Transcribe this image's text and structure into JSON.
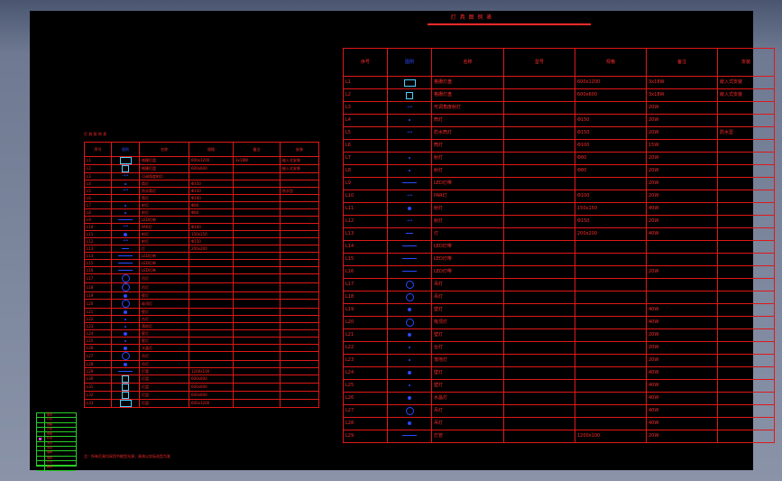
{
  "drawing": {
    "title": "灯 具 图 例 表"
  },
  "big_table": {
    "headers": [
      "序号",
      "图例",
      "名称",
      "型号",
      "规格",
      "备注",
      "安装"
    ],
    "rows": [
      {
        "no": "L1",
        "sym": "box",
        "name": "格栅灯盘",
        "model": "",
        "spec": "600x1200",
        "note": "3x18W",
        "install": "嵌入式安装"
      },
      {
        "no": "L2",
        "sym": "sq",
        "name": "格栅灯盘",
        "model": "",
        "spec": "600x600",
        "note": "3x18W",
        "install": "嵌入式安装"
      },
      {
        "no": "L3",
        "sym": "arrow",
        "name": "可调角度射灯",
        "model": "",
        "spec": "",
        "note": "20W",
        "install": ""
      },
      {
        "no": "L4",
        "sym": "dot-s",
        "name": "筒灯",
        "model": "",
        "spec": "Φ150",
        "note": "20W",
        "install": ""
      },
      {
        "no": "L5",
        "sym": "arrow",
        "name": "防水筒灯",
        "model": "",
        "spec": "Φ150",
        "note": "20W",
        "install": "防水型"
      },
      {
        "no": "L6",
        "sym": "blank",
        "name": "筒灯",
        "model": "",
        "spec": "Φ100",
        "note": "15W",
        "install": ""
      },
      {
        "no": "L7",
        "sym": "dot-s",
        "name": "射灯",
        "model": "",
        "spec": "Φ80",
        "note": "20W",
        "install": ""
      },
      {
        "no": "L8",
        "sym": "dot-s",
        "name": "射灯",
        "model": "",
        "spec": "Φ80",
        "note": "20W",
        "install": ""
      },
      {
        "no": "L9",
        "sym": "line",
        "name": "LED灯带",
        "model": "",
        "spec": "",
        "note": "20W",
        "install": ""
      },
      {
        "no": "L10",
        "sym": "arrow",
        "name": "PAR灯",
        "model": "",
        "spec": "Φ100",
        "note": "20W",
        "install": ""
      },
      {
        "no": "L11",
        "sym": "dot",
        "name": "射灯",
        "model": "",
        "spec": "150x150",
        "note": "40W",
        "install": ""
      },
      {
        "no": "L12",
        "sym": "arrow",
        "name": "射灯",
        "model": "",
        "spec": "Φ150",
        "note": "20W",
        "install": ""
      },
      {
        "no": "L13",
        "sym": "line-s",
        "name": "灯",
        "model": "",
        "spec": "200x200",
        "note": "40W",
        "install": ""
      },
      {
        "no": "L14",
        "sym": "line",
        "name": "LED灯带",
        "model": "",
        "spec": "",
        "note": "",
        "install": ""
      },
      {
        "no": "L15",
        "sym": "line",
        "name": "LED灯带",
        "model": "",
        "spec": "",
        "note": "",
        "install": ""
      },
      {
        "no": "L16",
        "sym": "line",
        "name": "LED灯带",
        "model": "",
        "spec": "",
        "note": "20W",
        "install": ""
      },
      {
        "no": "L17",
        "sym": "ring",
        "name": "吊灯",
        "model": "",
        "spec": "",
        "note": "",
        "install": ""
      },
      {
        "no": "L18",
        "sym": "ring",
        "name": "吊灯",
        "model": "",
        "spec": "",
        "note": "",
        "install": ""
      },
      {
        "no": "L19",
        "sym": "dot",
        "name": "壁灯",
        "model": "",
        "spec": "",
        "note": "40W",
        "install": ""
      },
      {
        "no": "L20",
        "sym": "ring",
        "name": "吸顶灯",
        "model": "",
        "spec": "",
        "note": "40W",
        "install": ""
      },
      {
        "no": "L21",
        "sym": "dot",
        "name": "壁灯",
        "model": "",
        "spec": "",
        "note": "20W",
        "install": ""
      },
      {
        "no": "L22",
        "sym": "dot-s",
        "name": "台灯",
        "model": "",
        "spec": "",
        "note": "20W",
        "install": ""
      },
      {
        "no": "L23",
        "sym": "dot-s",
        "name": "落地灯",
        "model": "",
        "spec": "",
        "note": "20W",
        "install": ""
      },
      {
        "no": "L24",
        "sym": "dot",
        "name": "壁灯",
        "model": "",
        "spec": "",
        "note": "40W",
        "install": ""
      },
      {
        "no": "L25",
        "sym": "dot-s",
        "name": "壁灯",
        "model": "",
        "spec": "",
        "note": "40W",
        "install": ""
      },
      {
        "no": "L26",
        "sym": "dot",
        "name": "水晶灯",
        "model": "",
        "spec": "",
        "note": "40W",
        "install": ""
      },
      {
        "no": "L27",
        "sym": "ring",
        "name": "吊灯",
        "model": "",
        "spec": "",
        "note": "40W",
        "install": ""
      },
      {
        "no": "L28",
        "sym": "dot",
        "name": "吊灯",
        "model": "",
        "spec": "",
        "note": "40W",
        "install": ""
      },
      {
        "no": "L29",
        "sym": "line",
        "name": "灯管",
        "model": "",
        "spec": "1200x100",
        "note": "20W",
        "install": ""
      }
    ]
  },
  "small_table": {
    "title": "灯 具 图 例 表",
    "headers": [
      "序号",
      "图例",
      "名称",
      "规格",
      "备注",
      "安装"
    ],
    "rows": [
      {
        "no": "L1",
        "sym": "box",
        "name": "格栅灯盘",
        "spec": "600x1200",
        "note": "3x18W",
        "install": "嵌入式安装"
      },
      {
        "no": "L2",
        "sym": "sq",
        "name": "格栅灯盘",
        "spec": "600x600",
        "note": "",
        "install": "嵌入式安装"
      },
      {
        "no": "L3",
        "sym": "arrow",
        "name": "可调角度射灯",
        "spec": "",
        "note": "",
        "install": ""
      },
      {
        "no": "L4",
        "sym": "dot-s",
        "name": "筒灯",
        "spec": "Φ150",
        "note": "",
        "install": ""
      },
      {
        "no": "L5",
        "sym": "arrow",
        "name": "防水筒灯",
        "spec": "Φ150",
        "note": "",
        "install": "防水型"
      },
      {
        "no": "L6",
        "sym": "blank",
        "name": "筒灯",
        "spec": "Φ100",
        "note": "",
        "install": ""
      },
      {
        "no": "L7",
        "sym": "dot-s",
        "name": "射灯",
        "spec": "Φ80",
        "note": "",
        "install": ""
      },
      {
        "no": "L8",
        "sym": "dot-s",
        "name": "射灯",
        "spec": "Φ80",
        "note": "",
        "install": ""
      },
      {
        "no": "L9",
        "sym": "line",
        "name": "LED灯带",
        "spec": "",
        "note": "",
        "install": ""
      },
      {
        "no": "L10",
        "sym": "arrow",
        "name": "PAR灯",
        "spec": "Φ100",
        "note": "",
        "install": ""
      },
      {
        "no": "L11",
        "sym": "dot",
        "name": "射灯",
        "spec": "150x150",
        "note": "",
        "install": ""
      },
      {
        "no": "L12",
        "sym": "arrow",
        "name": "射灯",
        "spec": "Φ150",
        "note": "",
        "install": ""
      },
      {
        "no": "L13",
        "sym": "line-s",
        "name": "灯",
        "spec": "200x200",
        "note": "",
        "install": ""
      },
      {
        "no": "L14",
        "sym": "line",
        "name": "LED灯带",
        "spec": "",
        "note": "",
        "install": ""
      },
      {
        "no": "L15",
        "sym": "line",
        "name": "LED灯带",
        "spec": "",
        "note": "",
        "install": ""
      },
      {
        "no": "L16",
        "sym": "line",
        "name": "LED灯带",
        "spec": "",
        "note": "",
        "install": ""
      },
      {
        "no": "L17",
        "sym": "ring",
        "name": "吊灯",
        "spec": "",
        "note": "",
        "install": ""
      },
      {
        "no": "L18",
        "sym": "ring",
        "name": "吊灯",
        "spec": "",
        "note": "",
        "install": ""
      },
      {
        "no": "L19",
        "sym": "dot",
        "name": "壁灯",
        "spec": "",
        "note": "",
        "install": ""
      },
      {
        "no": "L20",
        "sym": "ring",
        "name": "吸顶灯",
        "spec": "",
        "note": "",
        "install": ""
      },
      {
        "no": "L21",
        "sym": "dot",
        "name": "壁灯",
        "spec": "",
        "note": "",
        "install": ""
      },
      {
        "no": "L22",
        "sym": "dot-s",
        "name": "台灯",
        "spec": "",
        "note": "",
        "install": ""
      },
      {
        "no": "L23",
        "sym": "dot-s",
        "name": "落地灯",
        "spec": "",
        "note": "",
        "install": ""
      },
      {
        "no": "L24",
        "sym": "dot",
        "name": "壁灯",
        "spec": "",
        "note": "",
        "install": ""
      },
      {
        "no": "L25",
        "sym": "dot-s",
        "name": "壁灯",
        "spec": "",
        "note": "",
        "install": ""
      },
      {
        "no": "L26",
        "sym": "dot",
        "name": "水晶灯",
        "spec": "",
        "note": "",
        "install": ""
      },
      {
        "no": "L27",
        "sym": "ring",
        "name": "吊灯",
        "spec": "",
        "note": "",
        "install": ""
      },
      {
        "no": "L28",
        "sym": "dot",
        "name": "吊灯",
        "spec": "",
        "note": "",
        "install": ""
      },
      {
        "no": "L29",
        "sym": "line",
        "name": "灯管",
        "spec": "1200x100",
        "note": "",
        "install": ""
      },
      {
        "no": "L30",
        "sym": "sq",
        "name": "灯盘",
        "spec": "600x600",
        "note": "",
        "install": ""
      },
      {
        "no": "L31",
        "sym": "sq",
        "name": "灯盘",
        "spec": "600x600",
        "note": "",
        "install": ""
      },
      {
        "no": "L32",
        "sym": "sq",
        "name": "灯盘",
        "spec": "600x600",
        "note": "",
        "install": ""
      },
      {
        "no": "L33",
        "sym": "box",
        "name": "灯盘",
        "spec": "600x1200",
        "note": "",
        "install": ""
      }
    ]
  },
  "bottom_note": "注：所有灯具均采用节能型光源，具体以实际选型为准",
  "mini_legend": [
    "图层",
    "灯具",
    "线路",
    "开关",
    "插座",
    "标注",
    "文字",
    "家具",
    "墙体",
    "轴线",
    "尺寸",
    "其他"
  ]
}
